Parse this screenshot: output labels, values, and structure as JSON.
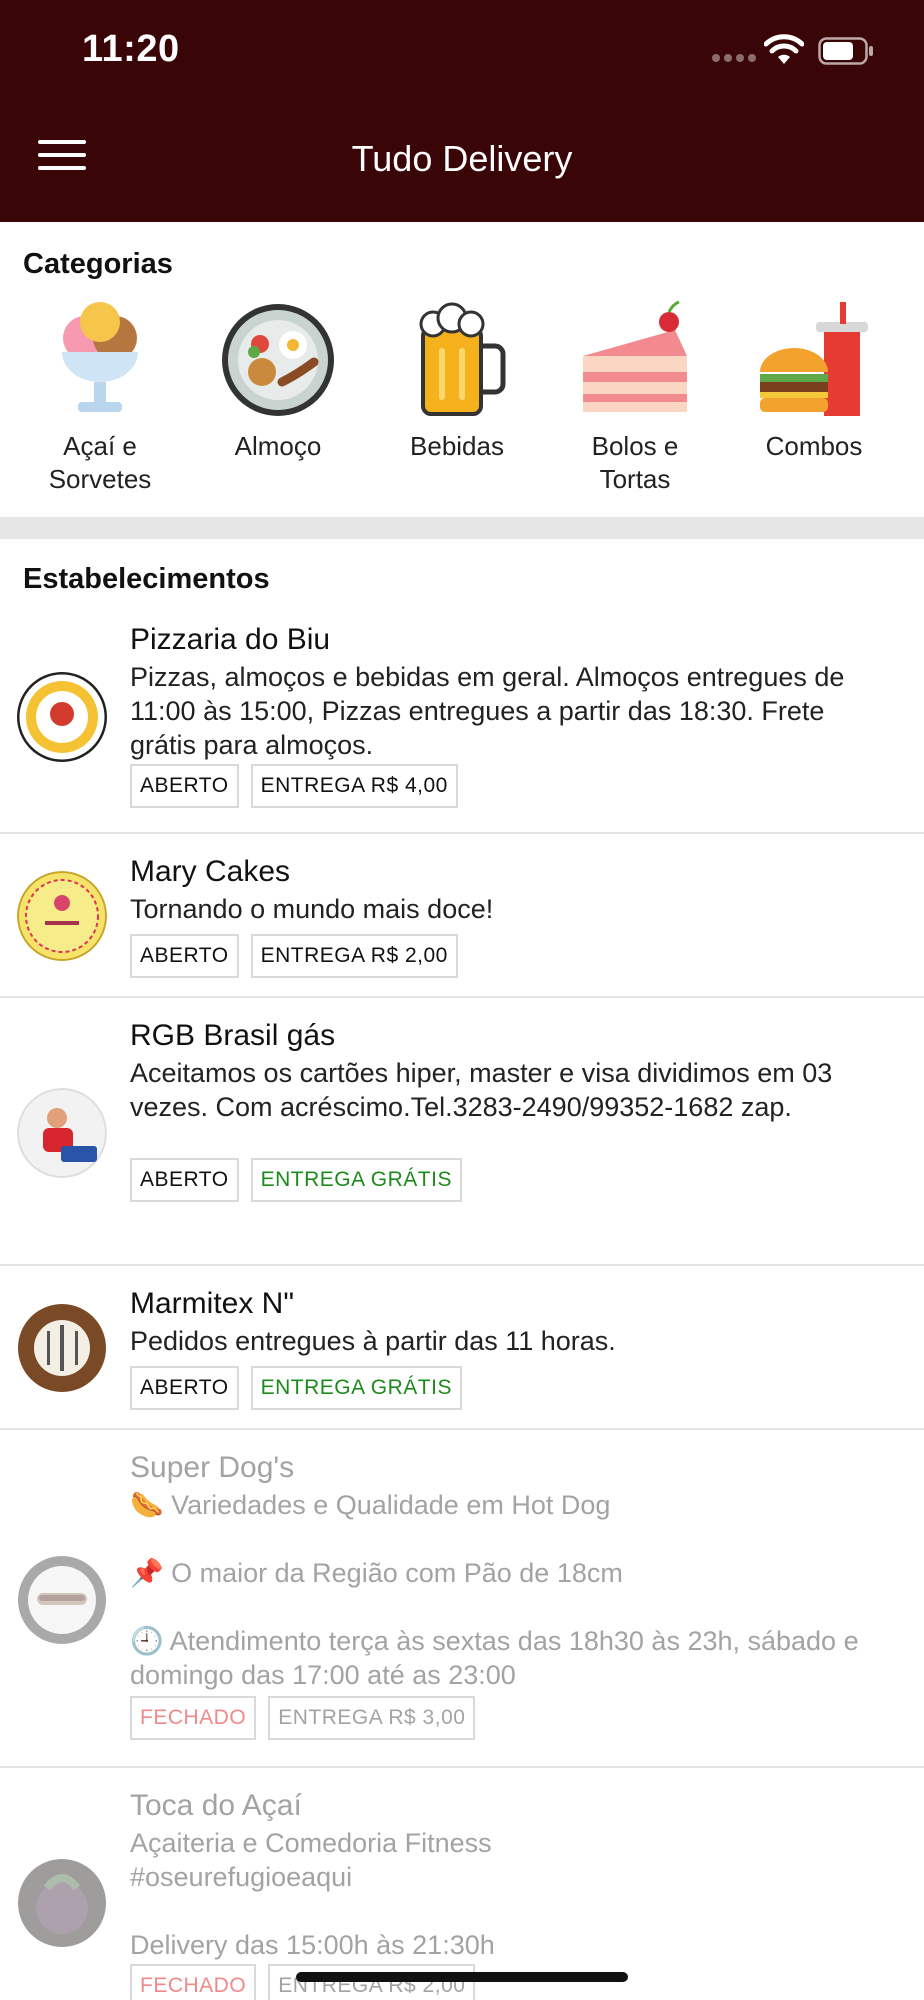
{
  "status_bar": {
    "time": "11:20"
  },
  "app_bar": {
    "title": "Tudo Delivery"
  },
  "categories": {
    "title": "Categorias",
    "items": [
      {
        "label": "Açaí e\nSorvetes",
        "icon": "ice-cream-cup-icon"
      },
      {
        "label": "Almoço",
        "icon": "lunch-plate-icon"
      },
      {
        "label": "Bebidas",
        "icon": "beer-mug-icon"
      },
      {
        "label": "Bolos e\nTortas",
        "icon": "cake-slice-icon"
      },
      {
        "label": "Combos",
        "icon": "burger-soda-icon"
      }
    ]
  },
  "establishments": {
    "title": "Estabelecimentos",
    "items": [
      {
        "name": "Pizzaria do Biu",
        "description": "Pizzas, almoços e bebidas em geral. Almoços entregues de 11:00 às 15:00, Pizzas entregues a partir das 18:30. Frete grátis para almoços.",
        "status": "ABERTO",
        "delivery": "ENTREGA R$ 4,00"
      },
      {
        "name": "Mary Cakes",
        "description": "Tornando o mundo mais doce!",
        "status": "ABERTO",
        "delivery": "ENTREGA R$ 2,00"
      },
      {
        "name": "RGB Brasil gás",
        "description": "Aceitamos os cartões hiper, master e visa dividimos em 03 vezes. Com acréscimo.Tel.3283-2490/99352-1682 zap.",
        "status": "ABERTO",
        "delivery": "ENTREGA GRÁTIS"
      },
      {
        "name": "Marmitex N\"",
        "description": "Pedidos entregues à partir das 11 horas.",
        "status": "ABERTO",
        "delivery": "ENTREGA GRÁTIS"
      },
      {
        "name": "Super Dog's",
        "description": "🌭 Variedades e Qualidade em Hot Dog\n\n📌 O maior da Região com Pão de 18cm\n\n🕘 Atendimento terça às sextas das 18h30 às 23h, sábado e domingo das 17:00 até as 23:00",
        "status": "FECHADO",
        "delivery": "ENTREGA R$ 3,00"
      },
      {
        "name": "Toca do Açaí",
        "description": "Açaiteria e Comedoria Fitness\n#oseurefugioeaqui\n\nDelivery das 15:00h às 21:30h",
        "status": "FECHADO",
        "delivery": "ENTREGA R$ 2,00"
      }
    ]
  },
  "colors": {
    "app_bar": "#3a0507",
    "free_delivery": "#1e8a1e",
    "closed_status": "#f08a8a"
  }
}
